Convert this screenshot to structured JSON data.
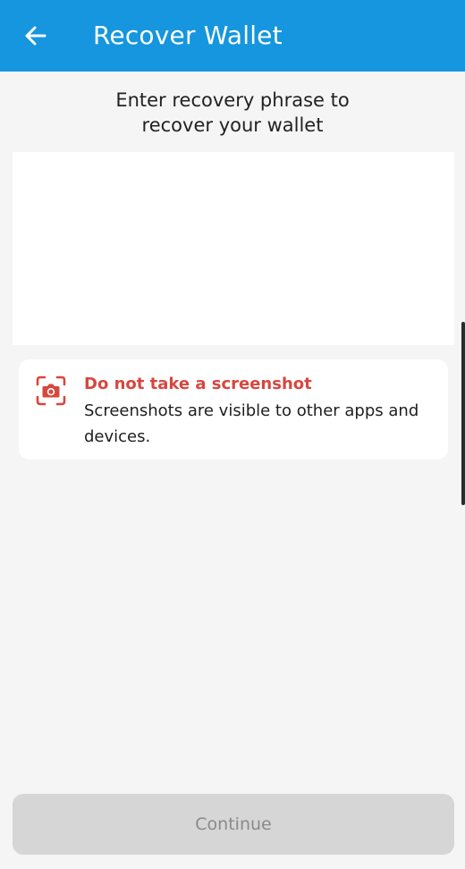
{
  "app_bar": {
    "title": "Recover Wallet",
    "back_icon": "arrow-left-icon",
    "background_color": "#1596de"
  },
  "instruction": {
    "line1": "Enter recovery phrase to",
    "line2": "recover your wallet"
  },
  "phrase_input": {
    "value": "",
    "placeholder": ""
  },
  "warning": {
    "icon": "camera-screenshot-icon",
    "title": "Do not take a screenshot",
    "text": "Screenshots are visible to other apps and devices.",
    "accent_color": "#d6473f"
  },
  "continue_button": {
    "label": "Continue",
    "enabled": false
  }
}
